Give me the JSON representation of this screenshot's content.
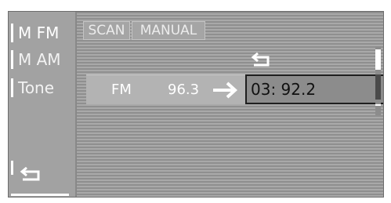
{
  "menu": {
    "items": [
      {
        "label": "M FM",
        "selected": true
      },
      {
        "label": "M AM",
        "selected": false
      },
      {
        "label": "Tone",
        "selected": false
      }
    ],
    "back_icon": "return-arrow-icon"
  },
  "tabs": {
    "scan_label": "SCAN",
    "manual_label": "MANUAL"
  },
  "station": {
    "band": "FM",
    "frequency": "96.3",
    "arrow_icon": "arrow-right-icon"
  },
  "preset": {
    "value": "03: 92.2"
  },
  "return_icon": "return-arrow-icon",
  "colors": {
    "background": "#878787",
    "highlight": "#ffffff",
    "text_dark": "#111111"
  }
}
